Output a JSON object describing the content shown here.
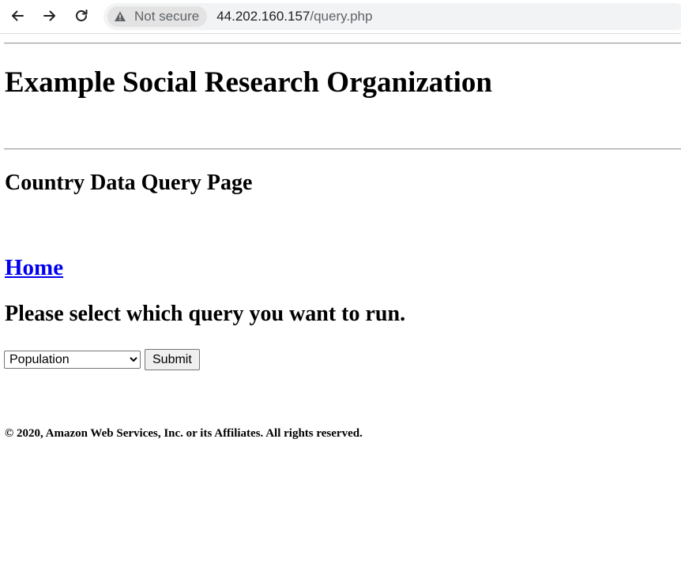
{
  "browser": {
    "security_label": "Not secure",
    "url_host": "44.202.160.157",
    "url_path": "/query.php"
  },
  "page": {
    "org_title": "Example Social Research Organization",
    "page_title": "Country Data Query Page",
    "home_link": "Home",
    "prompt": "Please select which query you want to run.",
    "query_select": {
      "selected": "Population"
    },
    "submit_label": "Submit",
    "footer": "© 2020, Amazon Web Services, Inc. or its Affiliates. All rights reserved."
  },
  "colors": {
    "link": "#0000ee",
    "chrome_bg": "#f1f3f4",
    "chip_bg": "#e3e3e3"
  },
  "icons": [
    "back-arrow-icon",
    "forward-arrow-icon",
    "reload-icon",
    "warning-triangle-icon"
  ]
}
